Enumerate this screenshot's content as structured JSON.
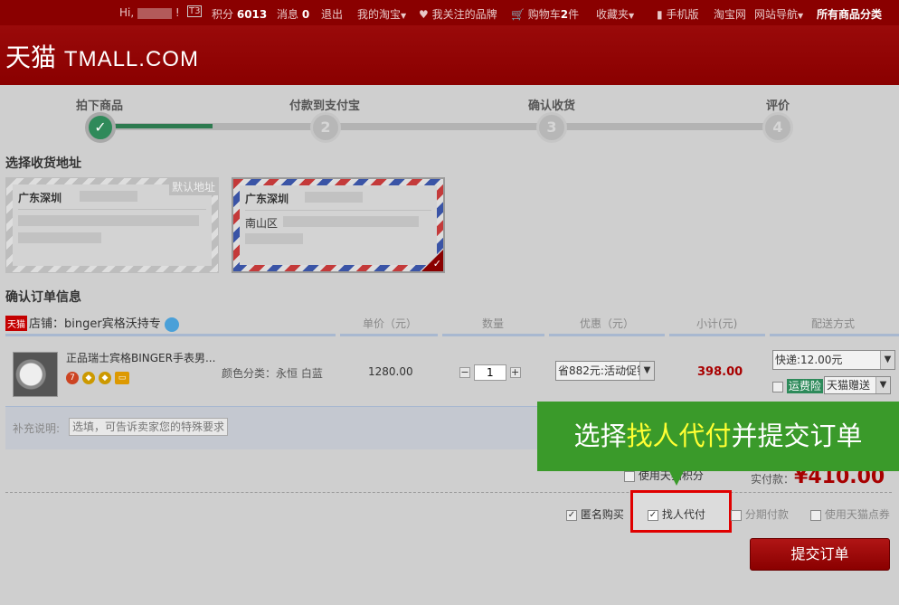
{
  "topbar": {
    "greeting": "Hi,",
    "points_label": "积分",
    "points_value": "6013",
    "messages_label": "消息",
    "messages_value": "0",
    "logout": "退出",
    "my_taobao": "我的淘宝",
    "brands": "我关注的品牌",
    "cart_label": "购物车",
    "cart_count": "2",
    "cart_unit": "件",
    "favorites": "收藏夹",
    "mobile": "手机版",
    "taobao": "淘宝网",
    "site_nav": "网站导航",
    "all_categories": "所有商品分类"
  },
  "logo": {
    "cn": "天猫",
    "en": "TMALL.COM"
  },
  "steps": [
    {
      "label": "拍下商品",
      "num": "✓"
    },
    {
      "label": "付款到支付宝",
      "num": "2"
    },
    {
      "label": "确认收货",
      "num": "3"
    },
    {
      "label": "评价",
      "num": "4"
    }
  ],
  "address_section": {
    "title": "选择收货地址",
    "cards": [
      {
        "city": "广东深圳",
        "street": "",
        "badge": "默认地址"
      },
      {
        "city": "广东深圳",
        "street": "南山区"
      }
    ]
  },
  "order_section": {
    "title": "确认订单信息",
    "shop_tag": "天猫",
    "shop_label": "店铺：binger宾格沃持专",
    "headers": {
      "price": "单价（元）",
      "qty": "数量",
      "discount": "优惠（元）",
      "subtotal": "小计(元)",
      "shipping": "配送方式"
    },
    "item": {
      "name": "正品瑞士宾格BINGER手表男...",
      "attr": "颜色分类：永恒 白蓝",
      "price": "1280.00",
      "qty": "1",
      "discount": "省882元:活动促销",
      "subtotal": "398.00",
      "shipping": "快递:12.00元",
      "insurance": "运费险",
      "gift": "天猫赠送"
    },
    "note_label": "补充说明:",
    "note_placeholder": "选填，可告诉卖家您的特殊要求"
  },
  "callout": {
    "before": "选择",
    "highlight": "找人代付",
    "after": "并提交订单"
  },
  "points_text": "使用天猫积分",
  "paid_label": "实付款：",
  "paid_value": "¥410.00",
  "options": {
    "anonymous": "匿名购买",
    "proxy_pay": "找人代付",
    "installment": "分期付款",
    "tmall_points": "使用天猫点券"
  },
  "submit_label": "提交订单"
}
